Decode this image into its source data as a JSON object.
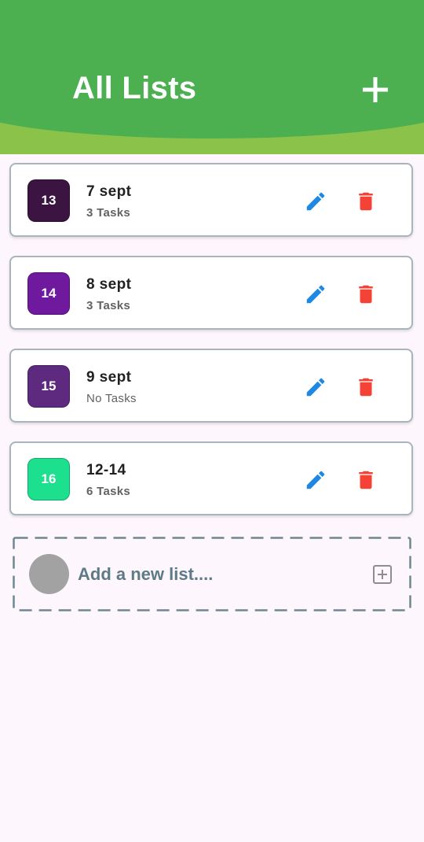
{
  "header": {
    "title": "All Lists",
    "add_icon": "plus-icon",
    "colors": {
      "top": "#4caf50",
      "bottom": "#8bc34a"
    }
  },
  "lists": [
    {
      "day": "13",
      "name": "7 sept",
      "count": "3 Tasks",
      "color": "#3b1442"
    },
    {
      "day": "14",
      "name": "8 sept",
      "count": "3 Tasks",
      "color": "#6f1a9e"
    },
    {
      "day": "15",
      "name": "9 sept",
      "count": "No Tasks",
      "color": "#5e2a80"
    },
    {
      "day": "16",
      "name": "12-14",
      "count": "6 Tasks",
      "color": "#1de08f"
    }
  ],
  "actions": {
    "edit_icon": "pencil-icon",
    "edit_color": "#1e88e5",
    "delete_icon": "trash-icon",
    "delete_color": "#f44336"
  },
  "new_list": {
    "placeholder": "Add a new list....",
    "add_icon": "plus-square-icon"
  }
}
